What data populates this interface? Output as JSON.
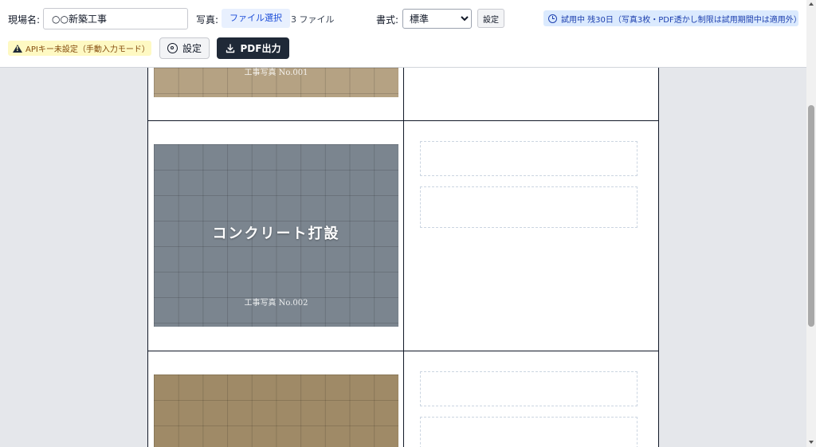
{
  "toolbar": {
    "site_label": "現場名:",
    "site_value": "○○新築工事",
    "photo_label": "写真:",
    "file_select_label": "ファイル選択",
    "file_count": "3 ファイル",
    "format_label": "書式:",
    "format_options": [
      "標準"
    ],
    "format_selected": "標準",
    "format_settings_label": "設定",
    "trial_text": "試用中 残30日（写真3枚・PDF透かし制限は試用期間中は適用外）",
    "api_warning": "APIキー未設定（手動入力モード）",
    "settings_label": "設定",
    "pdf_label": "PDF出力"
  },
  "rows": [
    {
      "title": "",
      "number": "工事写真 No.001",
      "color": "#b5a283"
    },
    {
      "title": "コンクリート打設",
      "number": "工事写真 No.002",
      "color": "#7b858f"
    },
    {
      "title": "",
      "number": "",
      "color": "#9f8a67"
    }
  ],
  "icons": {
    "trial": "clock-icon",
    "warning": "warning-triangle-icon",
    "settings": "gear-icon",
    "pdf": "download-icon"
  }
}
